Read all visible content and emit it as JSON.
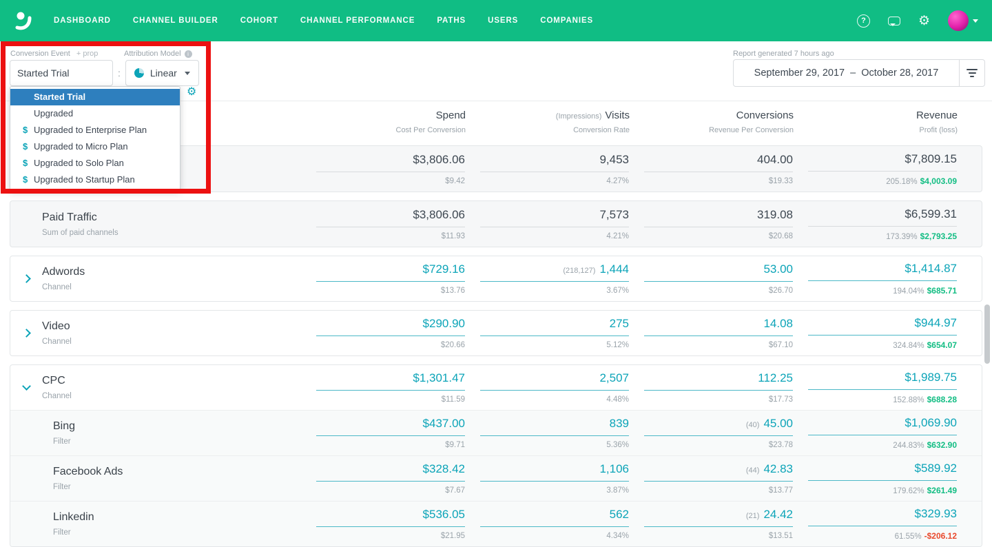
{
  "icons": {
    "gear": "⚙",
    "help": "?"
  },
  "nav": {
    "items": [
      {
        "label": "DASHBOARD"
      },
      {
        "label": "CHANNEL BUILDER"
      },
      {
        "label": "COHORT"
      },
      {
        "label": "CHANNEL PERFORMANCE"
      },
      {
        "label": "PATHS"
      },
      {
        "label": "USERS"
      },
      {
        "label": "COMPANIES"
      }
    ]
  },
  "header": {
    "conversion_event_label": "Conversion Event",
    "prop_label": "+ prop",
    "attribution_model_label": "Attribution Model",
    "conversion_event_value": "Started Trial",
    "colon": ":",
    "attribution_model_value": "Linear",
    "report_generated": "Report generated 7 hours ago",
    "date_range": "September 29, 2017  –  October 28, 2017"
  },
  "dropdown": {
    "items": [
      {
        "label": "Started Trial"
      },
      {
        "label": "Upgraded"
      },
      {
        "label": "Upgraded to Enterprise Plan",
        "dollar": "$"
      },
      {
        "label": "Upgraded to Micro Plan",
        "dollar": "$"
      },
      {
        "label": "Upgraded to Solo Plan",
        "dollar": "$"
      },
      {
        "label": "Upgraded to Startup Plan",
        "dollar": "$"
      }
    ]
  },
  "table": {
    "columns": [
      {
        "main": "Spend",
        "sub": "Cost Per Conversion"
      },
      {
        "pre": "(Impressions)",
        "main": "Visits",
        "sub": "Conversion Rate"
      },
      {
        "main": "Conversions",
        "sub": "Revenue Per Conversion"
      },
      {
        "main": "Revenue",
        "sub": "Profit (loss)"
      }
    ],
    "rows": [
      {
        "name": "",
        "sub": "",
        "spend": "$3,806.06",
        "spend_sub": "$9.42",
        "visits": "9,453",
        "visits_sub": "4.27%",
        "conv": "404.00",
        "conv_sub": "$19.33",
        "revenue": "$7,809.15",
        "profit_pct": "205.18%",
        "profit": "$4,003.09"
      },
      {
        "name": "Paid Traffic",
        "sub": "Sum of paid channels",
        "spend": "$3,806.06",
        "spend_sub": "$11.93",
        "visits": "7,573",
        "visits_sub": "4.21%",
        "conv": "319.08",
        "conv_sub": "$20.68",
        "revenue": "$6,599.31",
        "profit_pct": "173.39%",
        "profit": "$2,793.25"
      },
      {
        "name": "Adwords",
        "sub": "Channel",
        "spend": "$729.16",
        "spend_sub": "$13.76",
        "visits_pre": "(218,127)",
        "visits": "1,444",
        "visits_sub": "3.67%",
        "conv": "53.00",
        "conv_sub": "$26.70",
        "revenue": "$1,414.87",
        "profit_pct": "194.04%",
        "profit": "$685.71"
      },
      {
        "name": "Video",
        "sub": "Channel",
        "spend": "$290.90",
        "spend_sub": "$20.66",
        "visits": "275",
        "visits_sub": "5.12%",
        "conv": "14.08",
        "conv_sub": "$67.10",
        "revenue": "$944.97",
        "profit_pct": "324.84%",
        "profit": "$654.07"
      },
      {
        "name": "CPC",
        "sub": "Channel",
        "spend": "$1,301.47",
        "spend_sub": "$11.59",
        "visits": "2,507",
        "visits_sub": "4.48%",
        "conv": "112.25",
        "conv_sub": "$17.73",
        "revenue": "$1,989.75",
        "profit_pct": "152.88%",
        "profit": "$688.28"
      },
      {
        "name": "Bing",
        "sub": "Filter",
        "spend": "$437.00",
        "spend_sub": "$9.71",
        "visits": "839",
        "visits_sub": "5.36%",
        "conv_pre": "(40)",
        "conv": "45.00",
        "conv_sub": "$23.78",
        "revenue": "$1,069.90",
        "profit_pct": "244.83%",
        "profit": "$632.90"
      },
      {
        "name": "Facebook Ads",
        "sub": "Filter",
        "spend": "$328.42",
        "spend_sub": "$7.67",
        "visits": "1,106",
        "visits_sub": "3.87%",
        "conv_pre": "(44)",
        "conv": "42.83",
        "conv_sub": "$13.77",
        "revenue": "$589.92",
        "profit_pct": "179.62%",
        "profit": "$261.49"
      },
      {
        "name": "Linkedin",
        "sub": "Filter",
        "spend": "$536.05",
        "spend_sub": "$21.95",
        "visits": "562",
        "visits_sub": "4.34%",
        "conv_pre": "(21)",
        "conv": "24.42",
        "conv_sub": "$13.51",
        "revenue": "$329.93",
        "profit_pct": "61.55%",
        "profit": "-$206.12"
      }
    ]
  }
}
